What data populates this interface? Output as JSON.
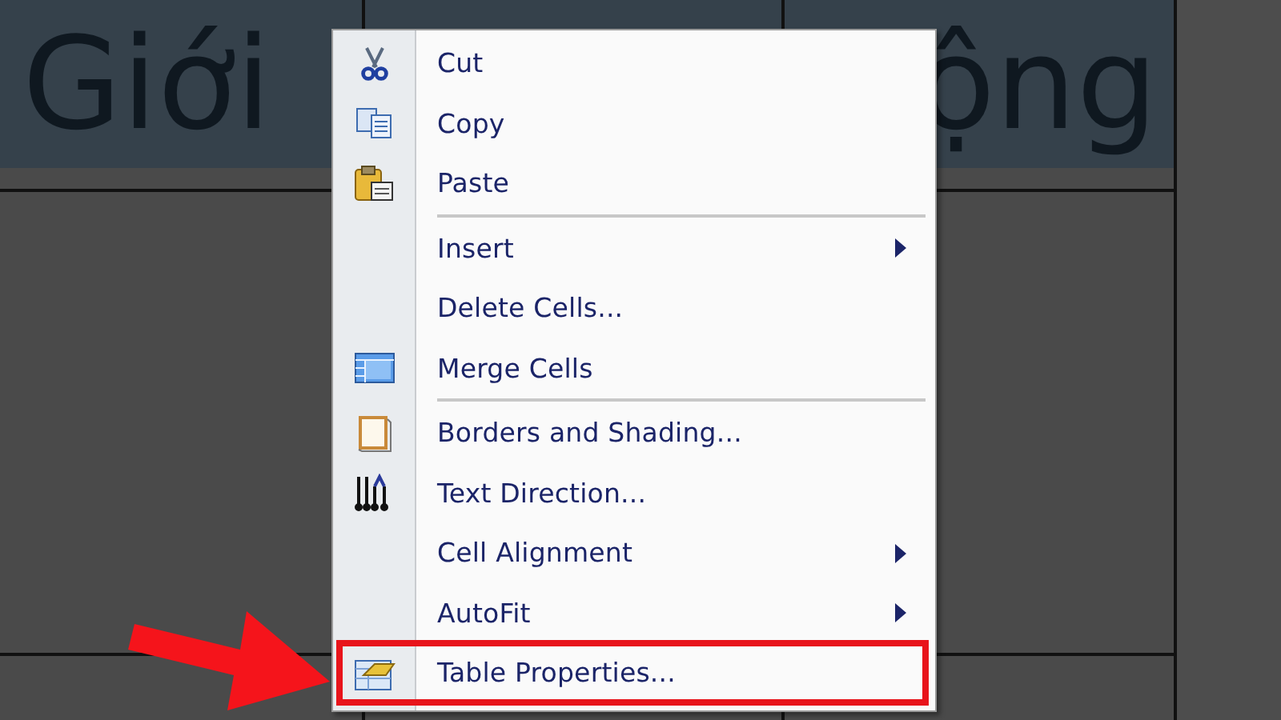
{
  "table": {
    "header_cells": [
      "Giới",
      "",
      "ộng"
    ]
  },
  "context_menu": {
    "items": [
      {
        "kind": "item",
        "label": "Cut",
        "submenu": false,
        "highlighted": false
      },
      {
        "kind": "item",
        "label": "Copy",
        "submenu": false,
        "highlighted": false
      },
      {
        "kind": "item",
        "label": "Paste",
        "submenu": false,
        "highlighted": false
      },
      {
        "kind": "separator"
      },
      {
        "kind": "item",
        "label": "Insert",
        "submenu": true,
        "highlighted": false
      },
      {
        "kind": "item",
        "label": "Delete Cells...",
        "submenu": false,
        "highlighted": false
      },
      {
        "kind": "item",
        "label": "Merge Cells",
        "submenu": false,
        "highlighted": false
      },
      {
        "kind": "separator"
      },
      {
        "kind": "item",
        "label": "Borders and Shading...",
        "submenu": false,
        "highlighted": false
      },
      {
        "kind": "item",
        "label": "Text Direction...",
        "submenu": false,
        "highlighted": false
      },
      {
        "kind": "item",
        "label": "Cell Alignment",
        "submenu": true,
        "highlighted": false
      },
      {
        "kind": "item",
        "label": "AutoFit",
        "submenu": true,
        "highlighted": false
      },
      {
        "kind": "item",
        "label": "Table Properties...",
        "submenu": false,
        "highlighted": true
      }
    ]
  }
}
